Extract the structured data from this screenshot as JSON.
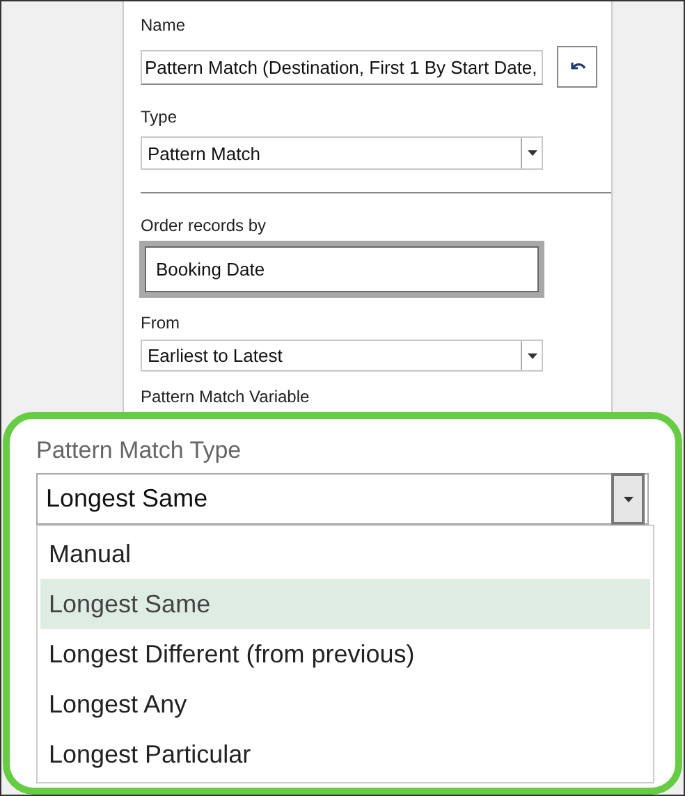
{
  "name_field": {
    "label": "Name",
    "value": "Pattern Match (Destination, First 1 By Start Date,"
  },
  "type_field": {
    "label": "Type",
    "value": "Pattern Match"
  },
  "order_by": {
    "label": "Order records by",
    "value": "Booking Date"
  },
  "from_field": {
    "label": "From",
    "value": "Earliest to Latest"
  },
  "variable_label": "Pattern Match Variable",
  "zoom_inset": {
    "label": "Pattern Match Type",
    "value": "Longest Same",
    "options": [
      {
        "label": "Manual",
        "selected": false
      },
      {
        "label": "Longest Same",
        "selected": true
      },
      {
        "label": "Longest Different (from previous)",
        "selected": false
      },
      {
        "label": "Longest Any",
        "selected": false
      },
      {
        "label": "Longest Particular",
        "selected": false
      }
    ]
  }
}
